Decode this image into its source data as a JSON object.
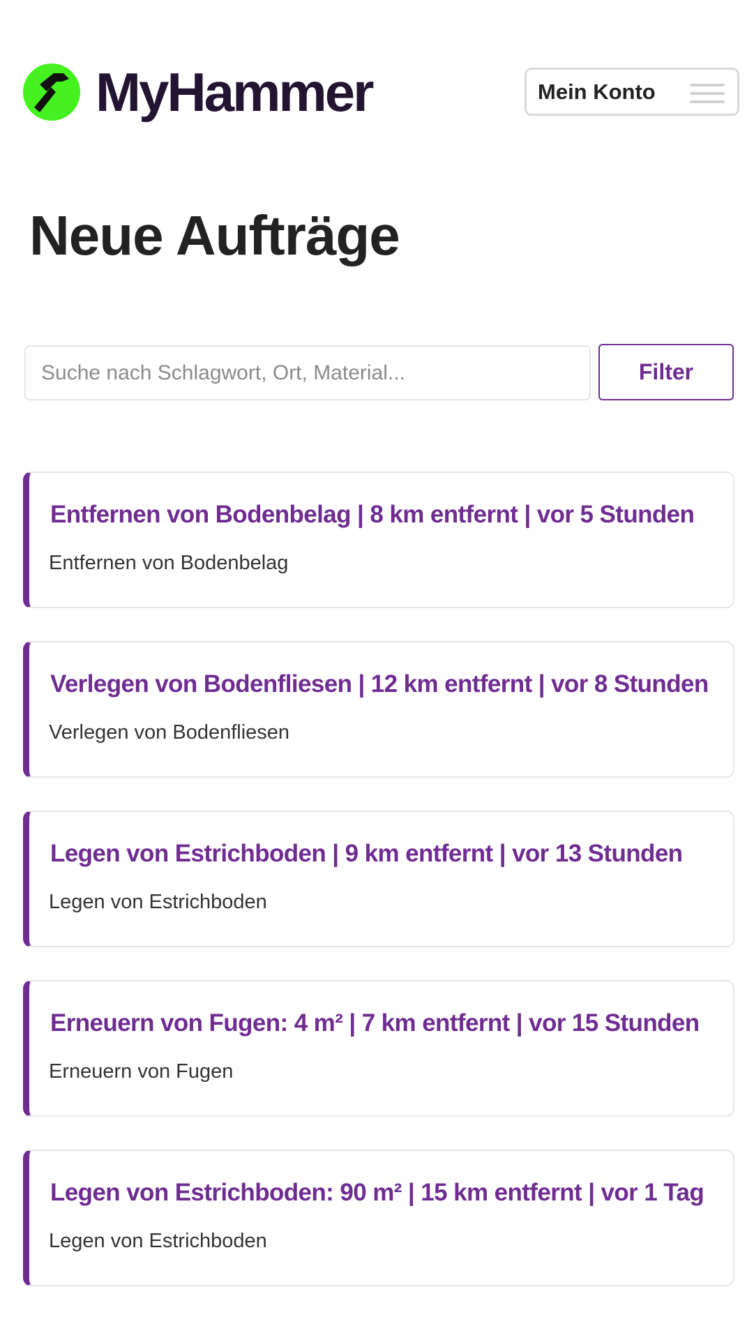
{
  "header": {
    "brand_name": "MyHammer",
    "account_label": "Mein Konto",
    "logo_color": "#45f21f",
    "brand_text_color": "#231432"
  },
  "page": {
    "title": "Neue Aufträge"
  },
  "search": {
    "placeholder": "Suche nach Schlagwort, Ort, Material...",
    "value": "",
    "filter_label": "Filter"
  },
  "accent_color": "#6f2c91",
  "jobs": [
    {
      "title": "Entfernen von Bodenbelag | 8 km entfernt | vor 5 Stunden",
      "subtitle": "Entfernen von Bodenbelag"
    },
    {
      "title": "Verlegen von Bodenfliesen | 12 km entfernt | vor 8 Stunden",
      "subtitle": "Verlegen von Bodenfliesen"
    },
    {
      "title": "Legen von Estrichboden | 9 km entfernt | vor 13 Stunden",
      "subtitle": "Legen von Estrichboden"
    },
    {
      "title": "Erneuern von Fugen: 4 m² | 7 km entfernt | vor 15 Stunden",
      "subtitle": "Erneuern von Fugen"
    },
    {
      "title": "Legen von Estrichboden: 90 m² | 15 km entfernt | vor 1 Tag",
      "subtitle": "Legen von Estrichboden"
    }
  ]
}
